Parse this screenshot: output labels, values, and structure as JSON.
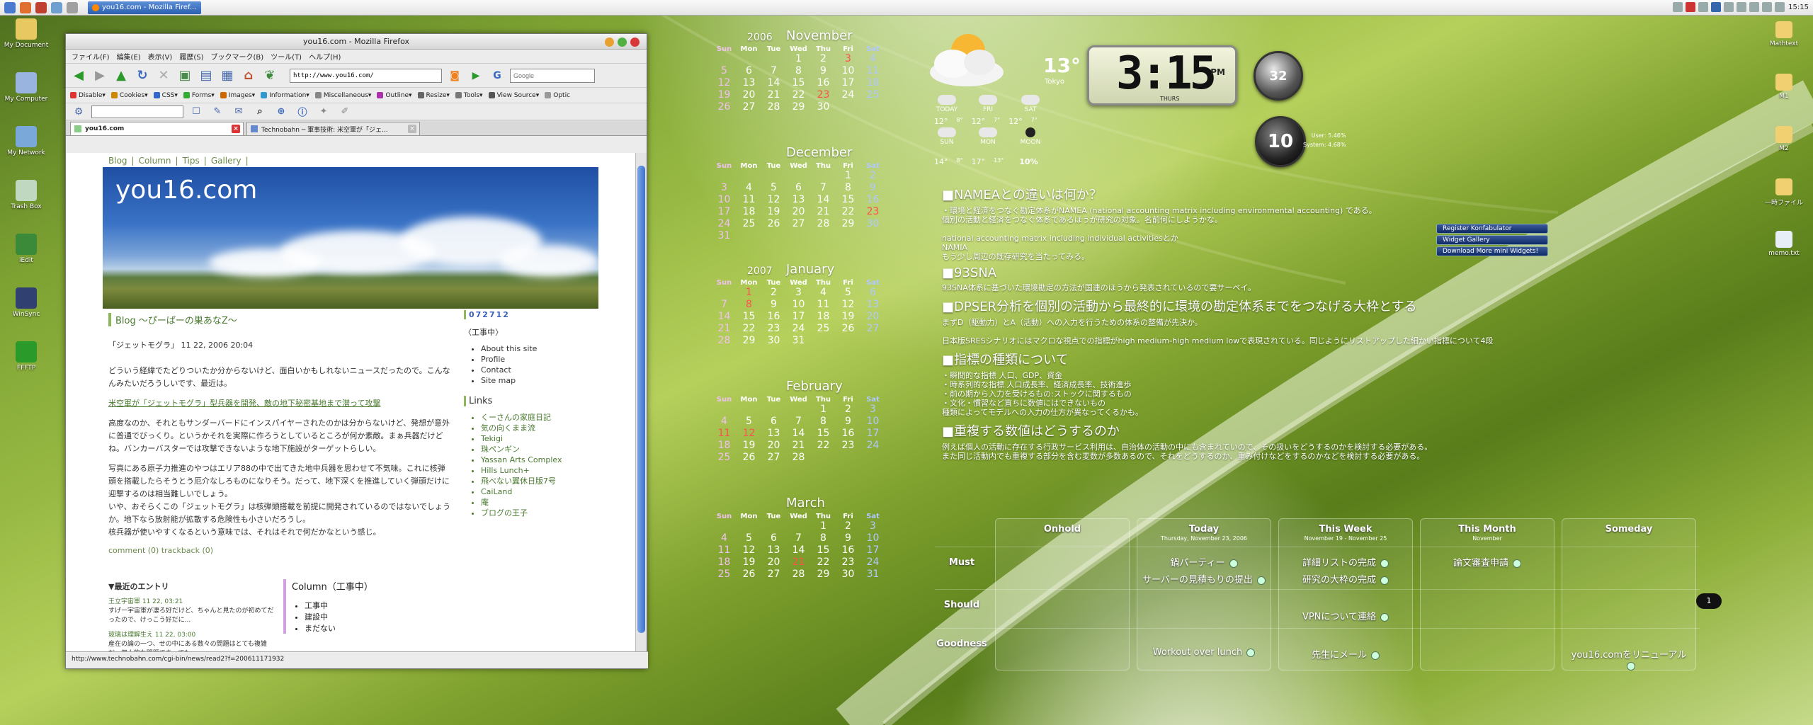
{
  "topbar": {
    "task_title": "you16.com - Mozilla Firef...",
    "clock": "15:15"
  },
  "desktop_left": [
    {
      "label": "My Document",
      "color": "#e8c860"
    },
    {
      "label": "My Computer",
      "color": "#9ab4e0"
    },
    {
      "label": "My Network",
      "color": "#7aa8d8"
    },
    {
      "label": "Trash Box",
      "color": "#c0d8c0"
    },
    {
      "label": "iEdit",
      "color": "#3a8a3a"
    },
    {
      "label": "WinSync",
      "color": "#304070"
    },
    {
      "label": "FFFTP",
      "color": "#2a9a2a"
    }
  ],
  "desktop_right": [
    {
      "label": "Mathtext",
      "color": "#f0d070"
    },
    {
      "label": "M1",
      "color": "#f0d070"
    },
    {
      "label": "M2",
      "color": "#f0d070"
    },
    {
      "label": "一時ファイル",
      "color": "#f0d070"
    },
    {
      "label": "memo.txt",
      "color": "#e8eef8"
    }
  ],
  "browser": {
    "title": "you16.com - Mozilla Firefox",
    "menu": [
      "ファイル(F)",
      "編集(E)",
      "表示(V)",
      "履歴(S)",
      "ブックマーク(B)",
      "ツール(T)",
      "ヘルプ(H)"
    ],
    "url": "http://www.you16.com/",
    "search_placeholder": "Google",
    "dev_toolbar": [
      "Disable▾",
      "Cookies▾",
      "CSS▾",
      "Forms▾",
      "Images▾",
      "Information▾",
      "Miscellaneous▾",
      "Outline▾",
      "Resize▾",
      "Tools▾",
      "View Source▾",
      "Optic"
    ],
    "tabs": [
      {
        "label": "you16.com"
      },
      {
        "label": "Technobahn ─ 軍事技術: 米空軍が「ジェ..."
      }
    ],
    "status": "http://www.technobahn.com/cgi-bin/news/read2?f=200611171932"
  },
  "site": {
    "nav": [
      "Blog",
      "|",
      "Column",
      "|",
      "Tips",
      "|",
      "Gallery",
      "|"
    ],
    "title": "you16.com",
    "blog_heading": "Blog ～ぴーぱーの巣あなZ～",
    "post_title": "「ジェットモグラ」 11 22, 2006 20:04",
    "p1": "どういう経緯でたどりついたか分からないけど、面白いかもしれないニュースだったので。こんなんみたいだろうしいです、最近は。",
    "link": "米空軍が「ジェットモグラ」型兵器を開発、敵の地下秘密基地まで潜って攻撃",
    "p2": "高度なのか、それともサンダーバードにインスパイヤーされたのかは分からないけど、発想が意外に普通でびっくり。というかそれを実際に作ろうとしているところが何か素敵。まぁ兵器だけどね。バンカーバスターでは攻撃できないような地下施設がターゲットらしい。",
    "p3": "写真にある原子力推進のやつはエリア88の中で出てきた地中兵器を思わせて不気味。これに核弾頭を搭載したらそうとう厄介なしろものになりそう。だって、地下深くを推進していく弾頭だけに迎撃するのは相当難しいでしょう。",
    "p4": "いや、おそらくこの「ジェットモグラ」は核弾頭搭載を前提に開発されているのではないでしょうか。地下なら放射能が拡散する危険性も小さいだろうし。",
    "p5": "核兵器が使いやすくなるという意味では、それはそれで何だかなという感じ。",
    "comments": "comment (0)   trackback (0)",
    "recent_heading": "▼最近のエントリ",
    "recent1_title": "王立宇宙軍 11 22, 03:21",
    "recent1_text": "すげー宇宙軍が凄ろ好だけど、ちゃんと見たのが初めてだったので、けっこう好だに...",
    "recent2_title": "玻璃は理解生え 11 22, 03:00",
    "recent2_text": "産在の論の一つ、せの中にある数々の問題はとても複雑だ。個人的な問題であっても...",
    "column_heading": "Column（工事中）",
    "column_items": [
      "工事中",
      "建設中",
      "まだない"
    ],
    "counter": "072712",
    "side_heading": "〈工事中〉",
    "side_items": [
      "About this site",
      "Profile",
      "Contact",
      "Site map"
    ],
    "links_heading": "Links",
    "links": [
      "くーさんの家庭日記",
      "気の向くまま流",
      "Tekigi",
      "珠ペンギン",
      "Yassan Arts Complex",
      "Hills Lunch+",
      "飛べない翼休日版7号",
      "CaiLand",
      "庵",
      "ブログの王子"
    ]
  },
  "calendars": [
    {
      "year": "2006",
      "month": "November",
      "lead": 3,
      "days": 30,
      "today": 23,
      "red": [
        3,
        23
      ]
    },
    {
      "year": "",
      "month": "December",
      "lead": 5,
      "days": 31,
      "today": 0,
      "red": [
        23
      ]
    },
    {
      "year": "2007",
      "month": "January",
      "lead": 1,
      "days": 31,
      "today": 0,
      "red": [
        1,
        8
      ]
    },
    {
      "year": "",
      "month": "February",
      "lead": 4,
      "days": 28,
      "today": 0,
      "red": [
        11,
        12
      ]
    },
    {
      "year": "",
      "month": "March",
      "lead": 4,
      "days": 31,
      "today": 0,
      "red": [
        21
      ]
    }
  ],
  "dows": [
    "Sun",
    "Mon",
    "Tue",
    "Wed",
    "Thu",
    "Fri",
    "Sat"
  ],
  "weather": {
    "temp": "13°",
    "city": "Tokyo",
    "days_top": [
      "TODAY",
      "FRI",
      "SAT"
    ],
    "temps_top": [
      "12°",
      "8°",
      "12°",
      "7°",
      "12°",
      "7°"
    ],
    "days_bottom": [
      "SUN",
      "MON",
      "MOON"
    ],
    "temps_bottom": [
      "14°",
      "8°",
      "17°",
      "13°"
    ],
    "moon": "10%"
  },
  "clock": {
    "time": "3:15",
    "ampm": "PM",
    "day": "THURS"
  },
  "dial1": "32",
  "dial2": "10",
  "cpu": {
    "user": "User: 5.46%",
    "system": "System: 4.68%"
  },
  "widget_links": [
    "Register Konfabulator",
    "Widget Gallery",
    "Download More mini Widgets!"
  ],
  "notes": [
    {
      "h": "■NAMEAとの違いは何か？",
      "p": "・環境と経済をつなぐ勘定体系がNAMEA (national accounting matrix including environmental accounting) である。\n個別の活動と経済をつなぐ体系であるほうが研究の対象。名前何にしようかな。\n\nnational accounting matrix including individual activitiesとか\nNAMIA\nもう少し周辺の既存研究を当たってみる。"
    },
    {
      "h": "■93SNA",
      "p": "93SNA体系に基づいた環境勘定の方法が国連のほうから発表されているので要サーベイ。"
    },
    {
      "h": "■DPSER分析を個別の活動から最終的に環境の勘定体系までをつなげる大枠とする",
      "p": "まずD（駆動力）とA（活動）への入力を行うための体系の整備が先決か。\n\n日本版SRESシナリオにはマクロな視点での指標がhigh medium-high medium lowで表現されている。同じようにリストアップした細かい指標について4段"
    },
    {
      "h": "■指標の種類について",
      "p": "・瞬間的な指標 人口、GDP、資金\n・時系列的な指標 人口成長率、経済成長率、技術進歩\n・前の期から入力を受けるもの:ストックに関するもの\n・文化・慣習など直ちに数値にはできないもの\n種類によってモデルへの入力の仕方が異なってくるかも。"
    },
    {
      "h": "■重複する数値はどうするのか",
      "p": "例えば個人の活動に存在する行政サービス利用は、自治体の活動の中にも含まれていので、その扱いをどうするのかを検討する必要がある。\nまた同じ活動内でも重複する部分を含む変数が多数あるので、それをどうするのか、重み付けなどをするのかなどを検討する必要がある。"
    }
  ],
  "tasks": {
    "columns": [
      {
        "title": "Onhold",
        "sub": ""
      },
      {
        "title": "Today",
        "sub": "Thursday, November 23, 2006"
      },
      {
        "title": "This Week",
        "sub": "November 19 - November 25"
      },
      {
        "title": "This Month",
        "sub": "November"
      },
      {
        "title": "Someday",
        "sub": ""
      }
    ],
    "rows": [
      "Must",
      "Should",
      "Goodness"
    ],
    "items": {
      "must_today_1": "鍋パーティー",
      "must_today_2": "サーバーの見積もりの提出",
      "must_week_1": "詳細リストの完成",
      "must_week_2": "研究の大枠の完成",
      "must_month_1": "論文審査申請",
      "should_week_1": "VPNについて連絡",
      "good_today_1": "Workout over lunch",
      "good_week_1": "先生にメール",
      "good_someday_1": "you16.comをリニューアル"
    },
    "sidetab": "1"
  }
}
